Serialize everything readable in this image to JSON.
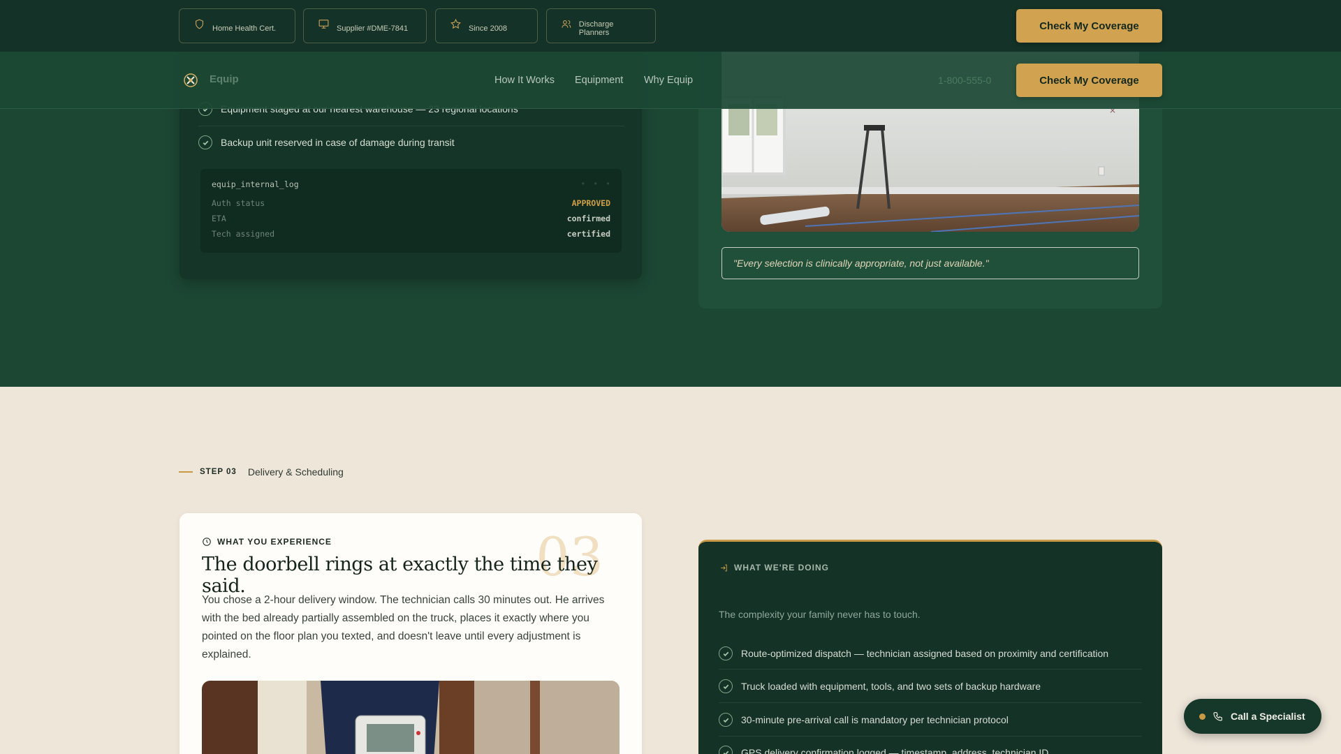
{
  "trust_badges": [
    {
      "icon": "shield-icon",
      "label": "Home Health Cert."
    },
    {
      "icon": "monitor-icon",
      "label": "Supplier #DME-7841"
    },
    {
      "icon": "star-icon",
      "label": "Since 2008"
    },
    {
      "icon": "users-icon",
      "label": "Discharge Planners"
    }
  ],
  "cta_label": "Check My Coverage",
  "nav": {
    "brand": "Equip",
    "links": [
      "How It Works",
      "Equipment",
      "Why Equip"
    ],
    "phone": "1-800-555-0"
  },
  "step02": {
    "checks": [
      "Equipment staged at our nearest warehouse — 23 regional locations",
      "Backup unit reserved in case of damage during transit"
    ],
    "log": {
      "title": "equip_internal_log",
      "rows": [
        {
          "key": "Auth status",
          "value": "APPROVED"
        },
        {
          "key": "ETA",
          "value": "confirmed"
        },
        {
          "key": "Tech assigned",
          "value": "certified"
        }
      ]
    },
    "quote": "\"Every selection is clinically appropriate, not just available.\""
  },
  "step03": {
    "step_num": "STEP 03",
    "step_title": "Delivery & Scheduling",
    "exp_kicker": "WHAT YOU EXPERIENCE",
    "big_number": "03",
    "heading": "The doorbell rings at exactly the time they said.",
    "body": "You chose a 2-hour delivery window. The technician calls 30 minutes out. He arrives with the bed already partially assembled on the truck, places it exactly where you pointed on the floor plan you texted, and doesn't leave until every adjustment is explained.",
    "doing_kicker": "WHAT WE'RE DOING",
    "doing_intro": "The complexity your family never has to touch.",
    "doing_items": [
      "Route-optimized dispatch — technician assigned based on proximity and certification",
      "Truck loaded with equipment, tools, and two sets of backup hardware",
      "30-minute pre-arrival call is mandatory per technician protocol",
      "GPS delivery confirmation logged — timestamp, address, technician ID"
    ]
  },
  "call_button": "Call a Specialist",
  "colors": {
    "accent": "#d1a24f",
    "dark_green": "#143227",
    "cream": "#efe6da"
  }
}
